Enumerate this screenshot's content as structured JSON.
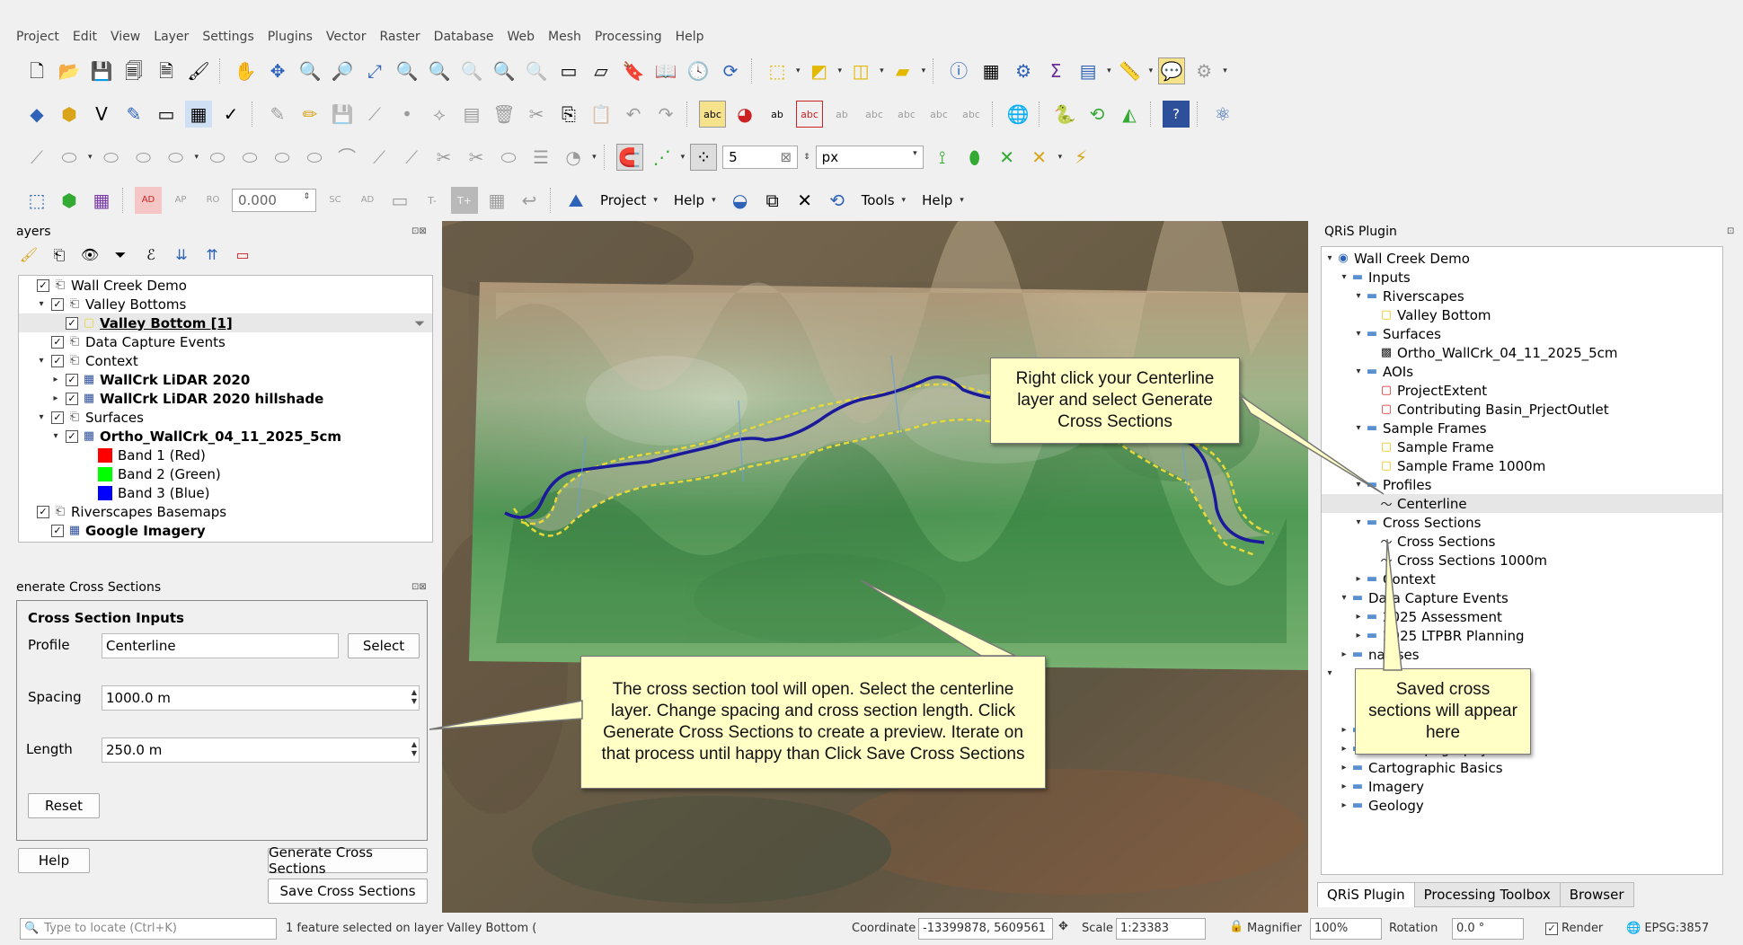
{
  "menu": [
    "Project",
    "Edit",
    "View",
    "Layer",
    "Settings",
    "Plugins",
    "Vector",
    "Raster",
    "Database",
    "Web",
    "Mesh",
    "Processing",
    "Help"
  ],
  "toolbar": {
    "snap_tolerance": "5",
    "snap_unit": "px",
    "angle_value": "0.000",
    "plugin_menu": [
      {
        "label": "Project"
      },
      {
        "label": "Help"
      },
      {
        "label": "Tools"
      },
      {
        "label": "Help"
      }
    ]
  },
  "layers_panel": {
    "title": "ayers",
    "items": [
      {
        "label": "Wall Creek Demo",
        "indent": 0,
        "arrow": "",
        "checked": true,
        "icon": "group",
        "bold": false
      },
      {
        "label": "Valley Bottoms",
        "indent": 1,
        "arrow": "▾",
        "checked": true,
        "icon": "group",
        "bold": false
      },
      {
        "label": "Valley Bottom [1]",
        "indent": 2,
        "arrow": "",
        "checked": true,
        "icon": "polygon",
        "bold": true,
        "selected": true
      },
      {
        "label": "Data Capture Events",
        "indent": 1,
        "arrow": "",
        "checked": true,
        "icon": "group",
        "bold": false
      },
      {
        "label": "Context",
        "indent": 1,
        "arrow": "▾",
        "checked": true,
        "icon": "group",
        "bold": false
      },
      {
        "label": "WallCrk LiDAR 2020",
        "indent": 2,
        "arrow": "▸",
        "checked": true,
        "icon": "raster",
        "bold": true
      },
      {
        "label": "WallCrk LiDAR 2020 hillshade",
        "indent": 2,
        "arrow": "▸",
        "checked": true,
        "icon": "raster",
        "bold": true
      },
      {
        "label": "Surfaces",
        "indent": 1,
        "arrow": "▾",
        "checked": true,
        "icon": "group",
        "bold": false
      },
      {
        "label": "Ortho_WallCrk_04_11_2025_5cm",
        "indent": 2,
        "arrow": "▾",
        "checked": true,
        "icon": "raster",
        "bold": true
      },
      {
        "label": "Band 1 (Red)",
        "indent": 3,
        "swatch": "#ff0000"
      },
      {
        "label": "Band 2 (Green)",
        "indent": 3,
        "swatch": "#00ff00"
      },
      {
        "label": "Band 3 (Blue)",
        "indent": 3,
        "swatch": "#0000ff"
      },
      {
        "label": "Riverscapes Basemaps",
        "indent": 0,
        "arrow": "",
        "checked": true,
        "icon": "group",
        "bold": false
      },
      {
        "label": "Google Imagery",
        "indent": 1,
        "arrow": "",
        "checked": true,
        "icon": "raster",
        "bold": true
      }
    ]
  },
  "gcs": {
    "title": "enerate Cross Sections",
    "group_title": "Cross Section Inputs",
    "profile_label": "Profile",
    "profile_value": "Centerline",
    "select_label": "Select",
    "spacing_label": "Spacing",
    "spacing_value": "1000.0 m",
    "length_label": "Length",
    "length_value": "250.0 m",
    "reset_label": "Reset",
    "help_label": "Help",
    "generate_label": "Generate Cross Sections",
    "save_label": "Save Cross Sections"
  },
  "qris": {
    "title": "QRiS Plugin",
    "items": [
      {
        "label": "Wall Creek Demo",
        "indent": 0,
        "arrow": "▾",
        "icon": "project"
      },
      {
        "label": "Inputs",
        "indent": 1,
        "arrow": "▾",
        "icon": "folder"
      },
      {
        "label": "Riverscapes",
        "indent": 2,
        "arrow": "▾",
        "icon": "folder"
      },
      {
        "label": "Valley Bottom",
        "indent": 3,
        "arrow": "",
        "icon": "poly-yellow"
      },
      {
        "label": "Surfaces",
        "indent": 2,
        "arrow": "▾",
        "icon": "folder"
      },
      {
        "label": "Ortho_WallCrk_04_11_2025_5cm",
        "indent": 3,
        "arrow": "",
        "icon": "raster"
      },
      {
        "label": "AOIs",
        "indent": 2,
        "arrow": "▾",
        "icon": "folder"
      },
      {
        "label": "ProjectExtent",
        "indent": 3,
        "arrow": "",
        "icon": "poly-red"
      },
      {
        "label": "Contributing Basin_PrjectOutlet",
        "indent": 3,
        "arrow": "",
        "icon": "poly-red"
      },
      {
        "label": "Sample Frames",
        "indent": 2,
        "arrow": "▾",
        "icon": "folder"
      },
      {
        "label": "Sample Frame",
        "indent": 3,
        "arrow": "",
        "icon": "poly-yellow"
      },
      {
        "label": "Sample Frame 1000m",
        "indent": 3,
        "arrow": "",
        "icon": "poly-yellow"
      },
      {
        "label": "Profiles",
        "indent": 2,
        "arrow": "▾",
        "icon": "folder"
      },
      {
        "label": "Centerline",
        "indent": 3,
        "arrow": "",
        "icon": "line",
        "selected": true
      },
      {
        "label": "Cross Sections",
        "indent": 2,
        "arrow": "▾",
        "icon": "folder"
      },
      {
        "label": "Cross Sections",
        "indent": 3,
        "arrow": "",
        "icon": "line"
      },
      {
        "label": "Cross Sections 1000m",
        "indent": 3,
        "arrow": "",
        "icon": "line"
      },
      {
        "label": "Context",
        "indent": 2,
        "arrow": "▸",
        "icon": "folder"
      },
      {
        "label": "Data Capture Events",
        "indent": 1,
        "arrow": "▾",
        "icon": "folder"
      },
      {
        "label": "2025 Assessment",
        "indent": 2,
        "arrow": "▸",
        "icon": "folder"
      },
      {
        "label": "2025 LTPBR Planning",
        "indent": 2,
        "arrow": "▸",
        "icon": "folder"
      },
      {
        "label": "nalyses",
        "indent": 1,
        "arrow": "▸",
        "icon": "folder"
      },
      {
        "label": "",
        "indent": 0,
        "arrow": "▾",
        "icon": ""
      },
      {
        "label": "",
        "indent": 1,
        "arrow": "",
        "icon": ""
      },
      {
        "label": "",
        "indent": 1,
        "arrow": "",
        "icon": ""
      },
      {
        "label": "USGS Hydrography",
        "indent": 1,
        "arrow": "▸",
        "icon": "folder"
      },
      {
        "label": "USGS Topography",
        "indent": 1,
        "arrow": "▸",
        "icon": "folder"
      },
      {
        "label": "Cartographic Basics",
        "indent": 1,
        "arrow": "▸",
        "icon": "folder"
      },
      {
        "label": "Imagery",
        "indent": 1,
        "arrow": "▸",
        "icon": "folder"
      },
      {
        "label": "Geology",
        "indent": 1,
        "arrow": "▸",
        "icon": "folder"
      }
    ],
    "tabs": [
      "QRiS Plugin",
      "Processing Toolbox",
      "Browser"
    ]
  },
  "status": {
    "locate_placeholder": "Type to locate (Ctrl+K)",
    "message": "1 feature selected on layer Valley Bottom (",
    "coord_label": "Coordinate",
    "coord_value": "-13399878, 5609561",
    "scale_label": "Scale",
    "scale_value": "1:23383",
    "magnifier_label": "Magnifier",
    "magnifier_value": "100%",
    "rotation_label": "Rotation",
    "rotation_value": "0.0 °",
    "render_label": "Render",
    "crs": "EPSG:3857"
  },
  "callouts": {
    "right_click": "Right click your Centerline layer and select Generate Cross Sections",
    "tool_open": "The cross section tool will open. Select the centerline layer. Change spacing and cross section length. Click Generate Cross Sections to create a preview. Iterate on that process until happy than Click Save Cross Sections",
    "saved": "Saved cross sections will appear here"
  }
}
